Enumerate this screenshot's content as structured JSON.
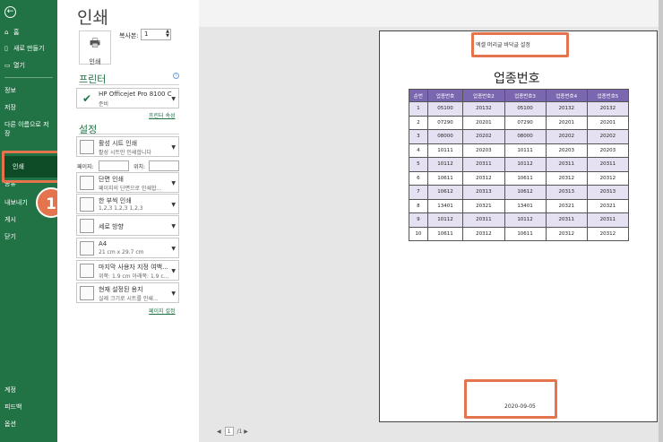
{
  "sidebar": {
    "back_icon": "back-arrow-icon",
    "items": [
      {
        "label": "홈",
        "icon": "home-icon"
      },
      {
        "label": "새로 만들기",
        "icon": "new-document-icon"
      },
      {
        "label": "열기",
        "icon": "folder-icon"
      },
      {
        "label": "정보"
      },
      {
        "label": "저장"
      },
      {
        "label": "다른 이름으로 저장"
      },
      {
        "label": "인쇄"
      },
      {
        "label": "공유"
      },
      {
        "label": "내보내기"
      },
      {
        "label": "게시"
      },
      {
        "label": "닫기"
      },
      {
        "label": "계정"
      },
      {
        "label": "피드백"
      },
      {
        "label": "옵션"
      }
    ],
    "badge": "1",
    "colors": {
      "bg": "#217346",
      "active": "#0e4b27",
      "highlight": "#e4744d"
    }
  },
  "panel": {
    "title": "인쇄",
    "print_button": {
      "label": "인쇄",
      "icon": "printer-icon"
    },
    "copies_label": "복사본:",
    "copies_value": "1",
    "printer_heading": "프린터",
    "printer": {
      "name": "HP Officejet Pro 8100 Cla...",
      "status": "준비",
      "icon": "printer-ready-icon"
    },
    "printer_props_link": "프린터 속성",
    "settings_heading": "설정",
    "settings": [
      {
        "main": "활성 시트 인쇄",
        "sub": "활성 시트만 인쇄합니다"
      },
      {
        "main": "단면 인쇄",
        "sub": "페이지의 단면으로 인쇄합..."
      },
      {
        "main": "한 부씩 인쇄",
        "sub": "1,2,3    1,2,3    1,2,3"
      },
      {
        "main": "세로 방향",
        "sub": ""
      },
      {
        "main": "A4",
        "sub": "21 cm x 29.7 cm"
      },
      {
        "main": "마지막 사용자 지정 여백...",
        "sub": "위쪽: 1.9 cm 아래쪽: 1.9 c..."
      },
      {
        "main": "현재 설정된 용지",
        "sub": "실제 크기로 시트를 인쇄..."
      }
    ],
    "pages_label": "페이지:",
    "to_label": "위치:",
    "page_setup_link": "페이지 설정"
  },
  "preview": {
    "header_text": "엑셀 머리글 바닥글 설정",
    "title": "업종번호",
    "columns": [
      "순번",
      "업종번호",
      "업종번호2",
      "업종번호3",
      "업종번호4",
      "업종번호5"
    ],
    "rows": [
      [
        "1",
        "05100",
        "20132",
        "05100",
        "20132",
        "20132"
      ],
      [
        "2",
        "07290",
        "20201",
        "07290",
        "20201",
        "20201"
      ],
      [
        "3",
        "08000",
        "20202",
        "08000",
        "20202",
        "20202"
      ],
      [
        "4",
        "10111",
        "20203",
        "10111",
        "20203",
        "20203"
      ],
      [
        "5",
        "10112",
        "20311",
        "10112",
        "20311",
        "20311"
      ],
      [
        "6",
        "10611",
        "20312",
        "10611",
        "20312",
        "20312"
      ],
      [
        "7",
        "10612",
        "20313",
        "10612",
        "20313",
        "20313"
      ],
      [
        "8",
        "13401",
        "20321",
        "13401",
        "20321",
        "20321"
      ],
      [
        "9",
        "10112",
        "20311",
        "10112",
        "20311",
        "20311"
      ],
      [
        "10",
        "10611",
        "20312",
        "10611",
        "20312",
        "20312"
      ]
    ],
    "footer_text": "2020-09-05",
    "pager": {
      "current": "1",
      "total": "/1",
      "prev": "◀",
      "next": "▶"
    }
  }
}
